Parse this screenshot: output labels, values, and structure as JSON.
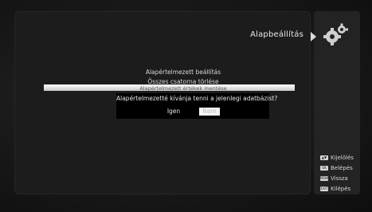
{
  "header": {
    "title": "Alapbeállítás",
    "icon": "gears-icon"
  },
  "menu": {
    "items": [
      "Alapértelmezett beállítás",
      "Összes csatorna törlése",
      "Alapértelmezett értékek mentése"
    ]
  },
  "dialog": {
    "question": "Alapértelmezetté kívánja tenni a jelenlegi adatbázist?",
    "yes_label": "Igen",
    "no_label": "Nem"
  },
  "legend": [
    {
      "key": "▲▼",
      "label": "Kijelölés"
    },
    {
      "key": "OK",
      "label": "Belépés"
    },
    {
      "key": "MENU",
      "label": "Vissza"
    },
    {
      "key": "EXIT",
      "label": "Kilépés"
    }
  ],
  "colors": {
    "background": "#0c0c0c",
    "highlight": "#ffffff",
    "text": "#e6e6e6"
  }
}
